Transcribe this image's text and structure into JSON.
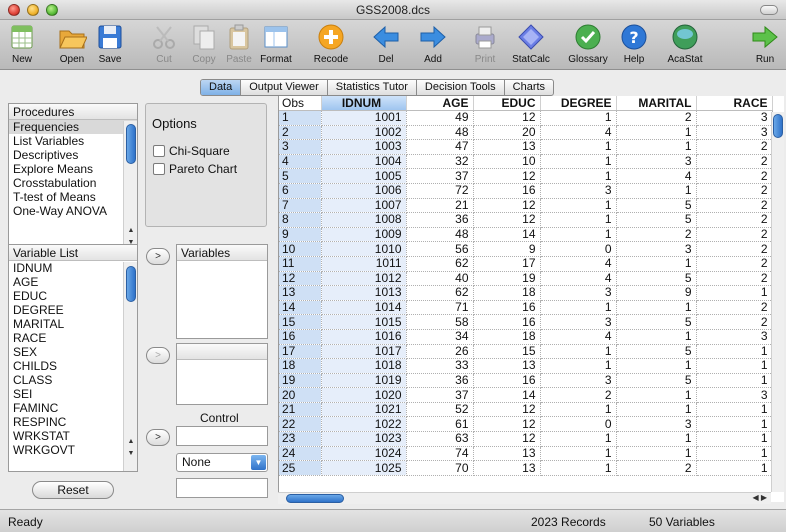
{
  "window": {
    "title": "GSS2008.dcs"
  },
  "toolbar": [
    {
      "label": "New",
      "icon": "table-icon",
      "enabled": true
    },
    {
      "label": "Open",
      "icon": "folder-open-icon",
      "enabled": true
    },
    {
      "label": "Save",
      "icon": "floppy-disk-icon",
      "enabled": true
    },
    {
      "label": "Cut",
      "icon": "scissors-icon",
      "enabled": false
    },
    {
      "label": "Copy",
      "icon": "copy-icon",
      "enabled": false
    },
    {
      "label": "Paste",
      "icon": "clipboard-icon",
      "enabled": false
    },
    {
      "label": "Format",
      "icon": "format-icon",
      "enabled": true
    },
    {
      "label": "Recode",
      "icon": "plus-circle-icon",
      "enabled": true
    },
    {
      "label": "Del",
      "icon": "arrow-left-icon",
      "enabled": true
    },
    {
      "label": "Add",
      "icon": "arrow-right-icon",
      "enabled": true
    },
    {
      "label": "Print",
      "icon": "printer-icon",
      "enabled": false
    },
    {
      "label": "StatCalc",
      "icon": "diamond-icon",
      "enabled": true
    },
    {
      "label": "Glossary",
      "icon": "checkmark-icon",
      "enabled": true
    },
    {
      "label": "Help",
      "icon": "question-icon",
      "enabled": true
    },
    {
      "label": "AcaStat",
      "icon": "globe-icon",
      "enabled": true
    },
    {
      "label": "Run",
      "icon": "run-arrow-icon",
      "enabled": true
    }
  ],
  "tabs": [
    {
      "label": "Data",
      "active": true
    },
    {
      "label": "Output Viewer",
      "active": false
    },
    {
      "label": "Statistics Tutor",
      "active": false
    },
    {
      "label": "Decision Tools",
      "active": false
    },
    {
      "label": "Charts",
      "active": false
    }
  ],
  "procedures": {
    "header": "Procedures",
    "items": [
      "Frequencies",
      "List Variables",
      "Descriptives",
      "Explore Means",
      "Crosstabulation",
      "T-test of Means",
      "One-Way ANOVA"
    ],
    "selected": "Frequencies"
  },
  "options": {
    "title": "Options",
    "checkboxes": [
      {
        "label": "Chi-Square",
        "checked": false
      },
      {
        "label": "Pareto Chart",
        "checked": false
      }
    ]
  },
  "variable_list": {
    "header": "Variable List",
    "items": [
      "IDNUM",
      "AGE",
      "EDUC",
      "DEGREE",
      "MARITAL",
      "RACE",
      "SEX",
      "CHILDS",
      "CLASS",
      "SEI",
      "FAMINC",
      "RESPINC",
      "WRKSTAT",
      "WRKGOVT"
    ]
  },
  "selection": {
    "variables_header": "Variables",
    "move_label": ">",
    "control_label": "Control",
    "control_select": "None"
  },
  "reset_label": "Reset",
  "grid": {
    "columns": [
      "Obs",
      "IDNUM",
      "AGE",
      "EDUC",
      "DEGREE",
      "MARITAL",
      "RACE"
    ],
    "rows": [
      [
        "1",
        "1001",
        "49",
        "12",
        "1",
        "2",
        "3"
      ],
      [
        "2",
        "1002",
        "48",
        "20",
        "4",
        "1",
        "3"
      ],
      [
        "3",
        "1003",
        "47",
        "13",
        "1",
        "1",
        "2"
      ],
      [
        "4",
        "1004",
        "32",
        "10",
        "1",
        "3",
        "2"
      ],
      [
        "5",
        "1005",
        "37",
        "12",
        "1",
        "4",
        "2"
      ],
      [
        "6",
        "1006",
        "72",
        "16",
        "3",
        "1",
        "2"
      ],
      [
        "7",
        "1007",
        "21",
        "12",
        "1",
        "5",
        "2"
      ],
      [
        "8",
        "1008",
        "36",
        "12",
        "1",
        "5",
        "2"
      ],
      [
        "9",
        "1009",
        "48",
        "14",
        "1",
        "2",
        "2"
      ],
      [
        "10",
        "1010",
        "56",
        "9",
        "0",
        "3",
        "2"
      ],
      [
        "11",
        "1011",
        "62",
        "17",
        "4",
        "1",
        "2"
      ],
      [
        "12",
        "1012",
        "40",
        "19",
        "4",
        "5",
        "2"
      ],
      [
        "13",
        "1013",
        "62",
        "18",
        "3",
        "9",
        "1"
      ],
      [
        "14",
        "1014",
        "71",
        "16",
        "1",
        "1",
        "2"
      ],
      [
        "15",
        "1015",
        "58",
        "16",
        "3",
        "5",
        "2"
      ],
      [
        "16",
        "1016",
        "34",
        "18",
        "4",
        "1",
        "3"
      ],
      [
        "17",
        "1017",
        "26",
        "15",
        "1",
        "5",
        "1"
      ],
      [
        "18",
        "1018",
        "33",
        "13",
        "1",
        "1",
        "1"
      ],
      [
        "19",
        "1019",
        "36",
        "16",
        "3",
        "5",
        "1"
      ],
      [
        "20",
        "1020",
        "37",
        "14",
        "2",
        "1",
        "3"
      ],
      [
        "21",
        "1021",
        "52",
        "12",
        "1",
        "1",
        "1"
      ],
      [
        "22",
        "1022",
        "61",
        "12",
        "0",
        "3",
        "1"
      ],
      [
        "23",
        "1023",
        "63",
        "12",
        "1",
        "1",
        "1"
      ],
      [
        "24",
        "1024",
        "74",
        "13",
        "1",
        "1",
        "1"
      ],
      [
        "25",
        "1025",
        "70",
        "13",
        "1",
        "2",
        "1"
      ]
    ]
  },
  "status": {
    "left": "Ready",
    "records": "2023 Records",
    "variables": "50 Variables"
  }
}
